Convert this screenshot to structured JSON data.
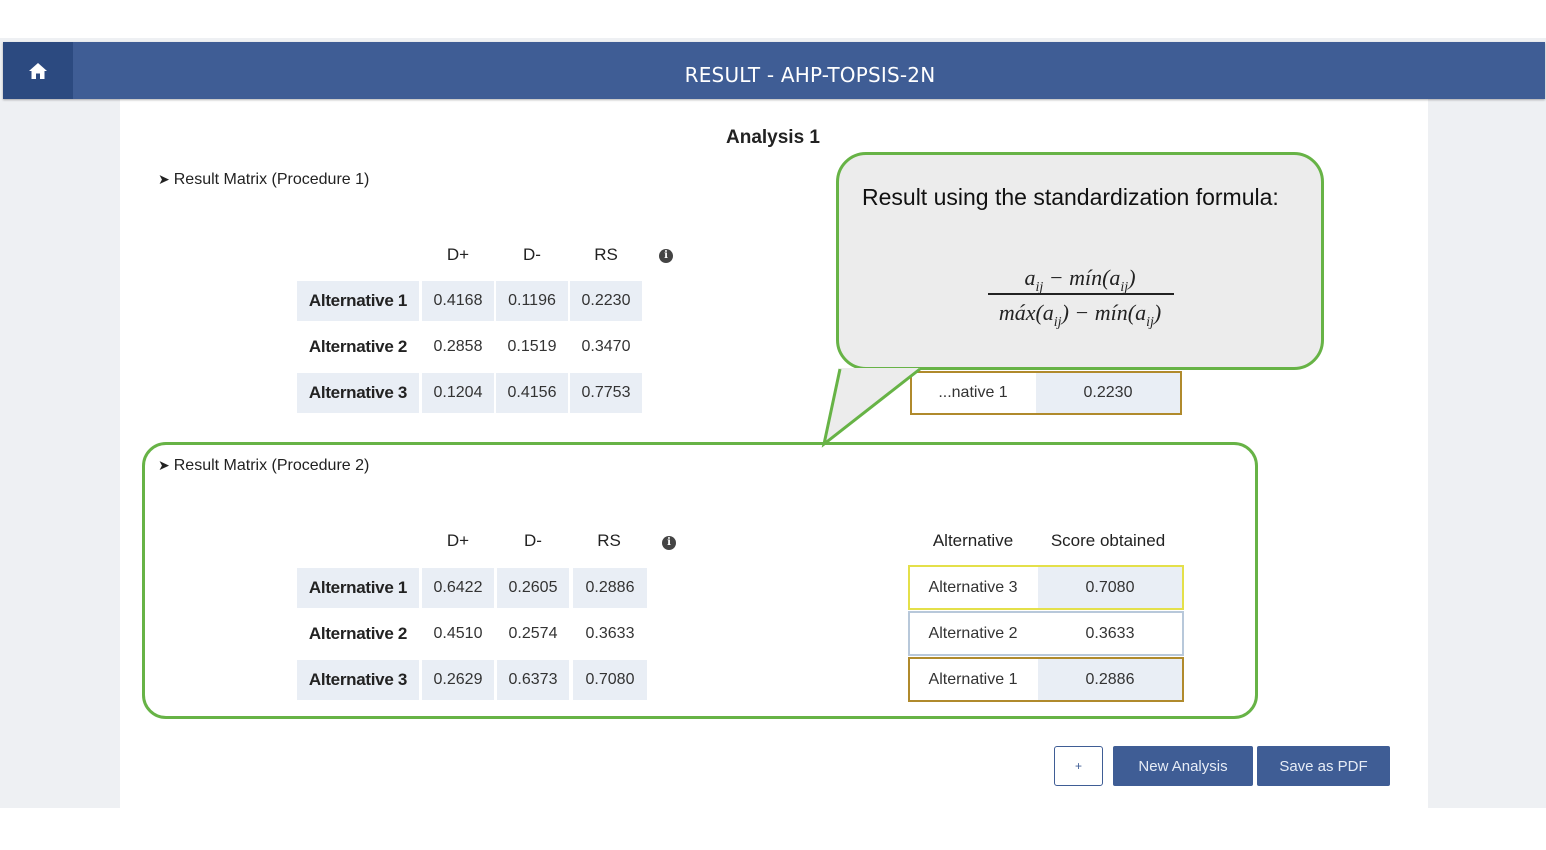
{
  "header": {
    "title": "RESULT - AHP-TOPSIS-2N",
    "home_icon": "home-icon"
  },
  "analysis_title": "Analysis 1",
  "procedure1": {
    "label": "Result Matrix (Procedure 1)",
    "columns": [
      "D+",
      "D-",
      "RS"
    ],
    "rows": [
      {
        "label": "Alternative 1",
        "values": [
          "0.4168",
          "0.1196",
          "0.2230"
        ]
      },
      {
        "label": "Alternative 2",
        "values": [
          "0.2858",
          "0.1519",
          "0.3470"
        ]
      },
      {
        "label": "Alternative 3",
        "values": [
          "0.1204",
          "0.4156",
          "0.7753"
        ]
      }
    ],
    "ranking_partial": {
      "alternative": "...native 1",
      "score": "0.2230"
    }
  },
  "procedure2": {
    "label": "Result Matrix (Procedure 2)",
    "columns": [
      "D+",
      "D-",
      "RS"
    ],
    "rows": [
      {
        "label": "Alternative 1",
        "values": [
          "0.6422",
          "0.2605",
          "0.2886"
        ]
      },
      {
        "label": "Alternative 2",
        "values": [
          "0.4510",
          "0.2574",
          "0.3633"
        ]
      },
      {
        "label": "Alternative 3",
        "values": [
          "0.2629",
          "0.6373",
          "0.7080"
        ]
      }
    ],
    "ranking_headers": {
      "alternative": "Alternative",
      "score": "Score obtained"
    },
    "ranking": [
      {
        "alternative": "Alternative 3",
        "score": "0.7080",
        "color": "#e4e04a"
      },
      {
        "alternative": "Alternative 2",
        "score": "0.3633",
        "color": "#b8c8da"
      },
      {
        "alternative": "Alternative 1",
        "score": "0.2886",
        "color": "#b08a2c"
      }
    ]
  },
  "callout": {
    "text": "Result using the standardization formula:",
    "formula_numerator": "a_ij − mín(a_ij)",
    "formula_denominator": "máx(a_ij) − mín(a_ij)"
  },
  "buttons": {
    "plus": "+",
    "new_analysis": "New Analysis",
    "save_pdf": "Save as PDF"
  },
  "colors": {
    "brand": "#3f5d95",
    "callout_border": "#67b346",
    "cell_bg": "#e9eef5"
  }
}
